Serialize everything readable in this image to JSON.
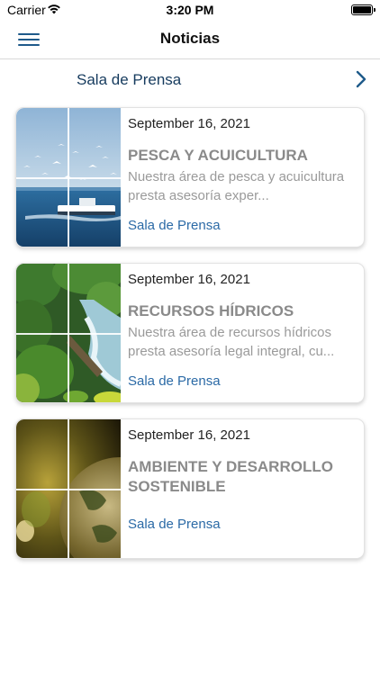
{
  "status_bar": {
    "carrier": "Carrier",
    "time": "3:20 PM"
  },
  "nav": {
    "title": "Noticias",
    "menu_icon": "hamburger-menu-icon"
  },
  "section": {
    "label": "Sala de Prensa",
    "chevron_icon": "chevron-right-icon"
  },
  "articles": [
    {
      "date": "September 16, 2021",
      "title": "PESCA Y ACUICULTURA",
      "description": "Nuestra área de pesca y acuicultura presta asesoría exper...",
      "category": "Sala de Prensa",
      "image": "seagulls-boat-sea-photo"
    },
    {
      "date": "September 16, 2021",
      "title": "RECURSOS HÍDRICOS",
      "description": " Nuestra área de recursos hídricos presta asesoría legal integral, cu...",
      "category": "Sala de Prensa",
      "image": "forest-river-photo"
    },
    {
      "date": "September 16, 2021",
      "title": "AMBIENTE Y DESARROLLO SOSTENIBLE",
      "description": "",
      "category": "Sala de Prensa",
      "image": "glass-globe-photo"
    }
  ],
  "colors": {
    "accent": "#1e5a8a",
    "section_label": "#163b5e",
    "category_link": "#2b6aa6",
    "title_gray": "#8a8a8a"
  }
}
